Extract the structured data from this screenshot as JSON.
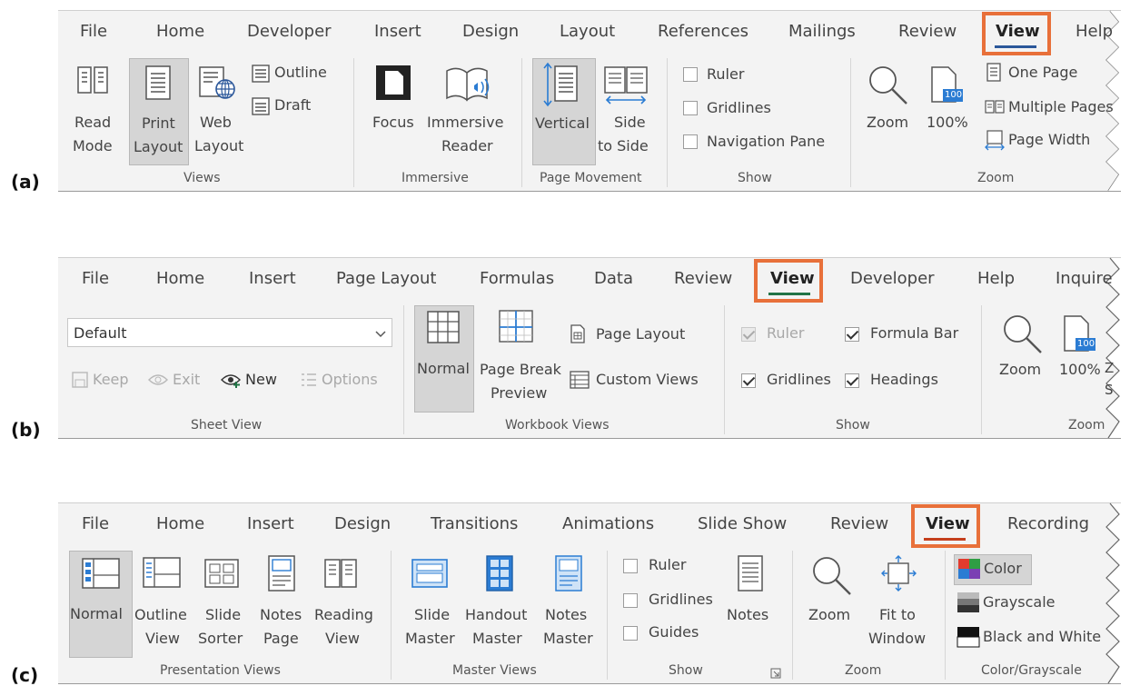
{
  "panels": [
    {
      "letter": "(a)"
    },
    {
      "letter": "(b)"
    },
    {
      "letter": "(c)"
    }
  ],
  "word": {
    "tabs": [
      "File",
      "Home",
      "Developer",
      "Insert",
      "Design",
      "Layout",
      "References",
      "Mailings",
      "Review",
      "View",
      "Help"
    ],
    "active_tab": "View",
    "active_color": "#2b579a",
    "views": {
      "read_mode": [
        "Read",
        "Mode"
      ],
      "print_layout": [
        "Print",
        "Layout"
      ],
      "web_layout": [
        "Web",
        "Layout"
      ],
      "outline": "Outline",
      "draft": "Draft",
      "group": "Views"
    },
    "immersive": {
      "focus": "Focus",
      "immersive_reader": [
        "Immersive",
        "Reader"
      ],
      "group": "Immersive"
    },
    "page_movement": {
      "vertical": "Vertical",
      "side_to_side": [
        "Side",
        "to Side"
      ],
      "group": "Page Movement"
    },
    "show": {
      "ruler": "Ruler",
      "gridlines": "Gridlines",
      "navigation_pane": "Navigation Pane",
      "group": "Show"
    },
    "zoom": {
      "zoom": "Zoom",
      "hundred": "100%",
      "one_page": "One Page",
      "multiple_pages": "Multiple Pages",
      "page_width": "Page Width",
      "group": "Zoom",
      "badge": "100"
    }
  },
  "excel": {
    "tabs": [
      "File",
      "Home",
      "Insert",
      "Page Layout",
      "Formulas",
      "Data",
      "Review",
      "View",
      "Developer",
      "Help",
      "Inquire"
    ],
    "active_tab": "View",
    "active_color": "#217346",
    "sheet_view": {
      "dropdown_value": "Default",
      "keep": "Keep",
      "exit": "Exit",
      "new": "New",
      "options": "Options",
      "group": "Sheet View"
    },
    "workbook_views": {
      "normal": "Normal",
      "page_break": [
        "Page Break",
        "Preview"
      ],
      "page_layout": "Page Layout",
      "custom_views": "Custom Views",
      "group": "Workbook Views"
    },
    "show": {
      "ruler": "Ruler",
      "formula_bar": "Formula Bar",
      "gridlines": "Gridlines",
      "headings": "Headings",
      "group": "Show"
    },
    "zoom": {
      "zoom": "Zoom",
      "hundred": "100%",
      "group": "Zoom",
      "badge": "100",
      "cut_a": "Z",
      "cut_b": "S"
    }
  },
  "powerpoint": {
    "tabs": [
      "File",
      "Home",
      "Insert",
      "Design",
      "Transitions",
      "Animations",
      "Slide Show",
      "Review",
      "View",
      "Recording"
    ],
    "active_tab": "View",
    "active_color": "#c43e1c",
    "presentation_views": {
      "normal": "Normal",
      "outline": [
        "Outline",
        "View"
      ],
      "sorter": [
        "Slide",
        "Sorter"
      ],
      "notes_page": [
        "Notes",
        "Page"
      ],
      "reading": [
        "Reading",
        "View"
      ],
      "group": "Presentation Views"
    },
    "master_views": {
      "slide": [
        "Slide",
        "Master"
      ],
      "handout": [
        "Handout",
        "Master"
      ],
      "notes": [
        "Notes",
        "Master"
      ],
      "group": "Master Views"
    },
    "show": {
      "ruler": "Ruler",
      "gridlines": "Gridlines",
      "guides": "Guides",
      "notes": "Notes",
      "group": "Show"
    },
    "zoom": {
      "zoom": "Zoom",
      "fit": [
        "Fit to",
        "Window"
      ],
      "group": "Zoom"
    },
    "color": {
      "color": "Color",
      "grayscale": "Grayscale",
      "bw": "Black and White",
      "group": "Color/Grayscale"
    }
  },
  "highlight_color": "#e8703a"
}
